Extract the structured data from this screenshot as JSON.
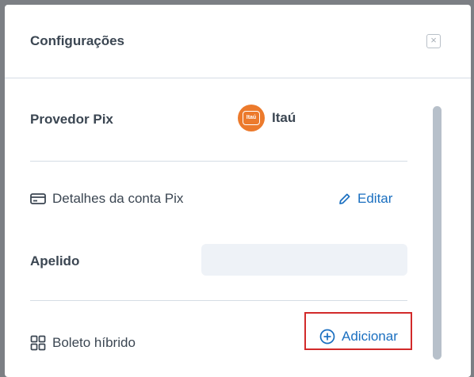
{
  "modal": {
    "title": "Configurações",
    "close_symbol": "×"
  },
  "provider": {
    "label": "Provedor Pix",
    "name": "Itaú",
    "logo_text": "Itaú",
    "logo_color": "#ec7a2c"
  },
  "account": {
    "label": "Detalhes da conta Pix",
    "icon": "card-icon",
    "edit_label": "Editar",
    "edit_icon": "pencil-icon"
  },
  "nickname": {
    "label": "Apelido",
    "value": ""
  },
  "boleto": {
    "label": "Boleto híbrido",
    "icon": "grid-icon",
    "add_label": "Adicionar",
    "add_icon": "plus-circle-icon"
  },
  "colors": {
    "link": "#1a6fc0",
    "highlight": "#d22a2a"
  }
}
